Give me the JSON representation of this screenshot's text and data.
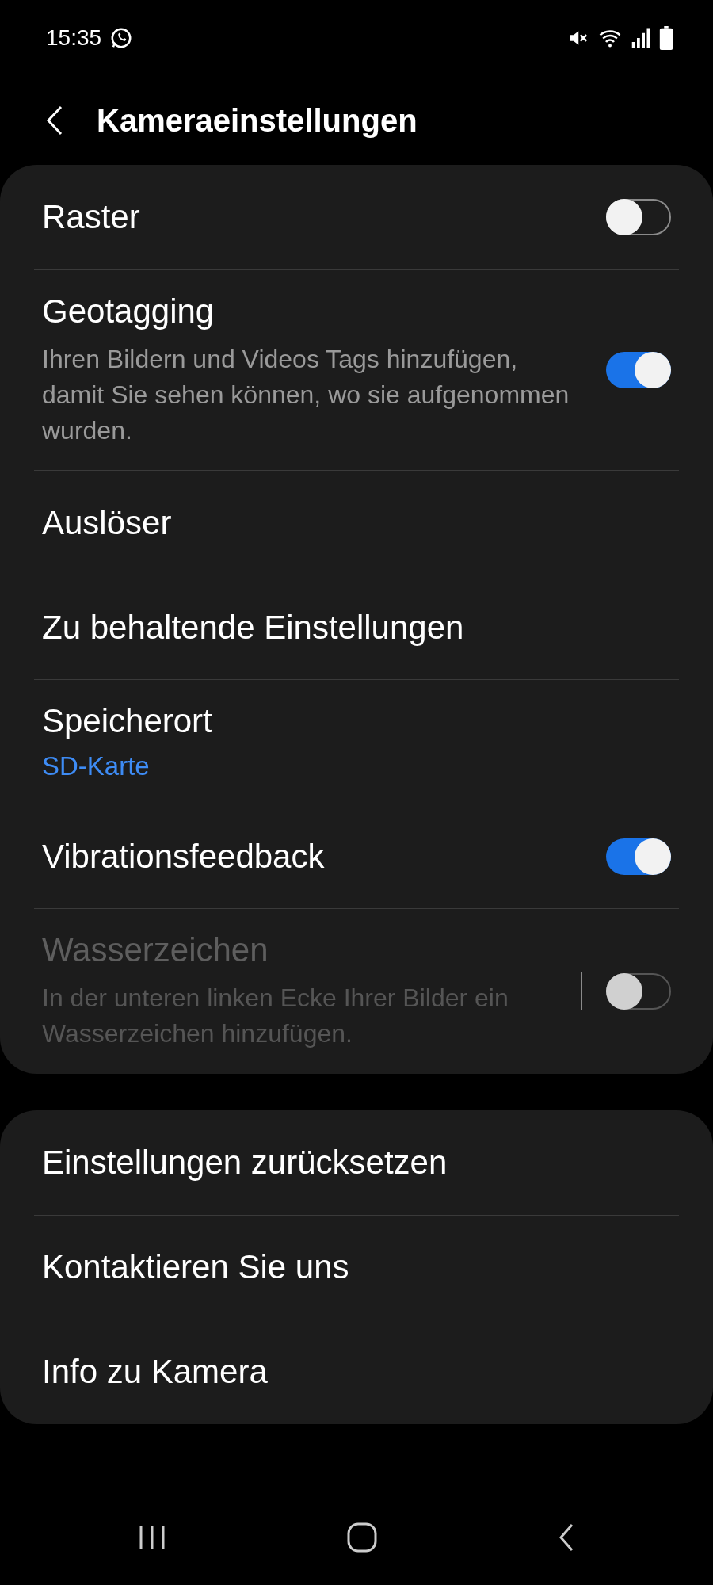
{
  "status_bar": {
    "time": "15:35"
  },
  "header": {
    "title": "Kameraeinstellungen"
  },
  "groups": [
    {
      "items": [
        {
          "kind": "toggle",
          "title": "Raster",
          "on": false,
          "disabled": false
        },
        {
          "kind": "toggle",
          "title": "Geotagging",
          "subtitle": "Ihren Bildern und Videos Tags hinzufügen, damit Sie sehen können, wo sie aufgenommen wurden.",
          "on": true,
          "disabled": false
        },
        {
          "kind": "link",
          "title": "Auslöser"
        },
        {
          "kind": "link",
          "title": "Zu behaltende Einstellungen"
        },
        {
          "kind": "link",
          "title": "Speicherort",
          "value": "SD-Karte"
        },
        {
          "kind": "toggle",
          "title": "Vibrationsfeedback",
          "on": true,
          "disabled": false
        },
        {
          "kind": "toggle",
          "title": "Wasserzeichen",
          "subtitle": "In der unteren linken Ecke Ihrer Bilder ein Wasserzeichen hinzufügen.",
          "on": false,
          "disabled": true
        }
      ]
    },
    {
      "items": [
        {
          "kind": "link",
          "title": "Einstellungen zurücksetzen"
        },
        {
          "kind": "link",
          "title": "Kontaktieren Sie uns"
        },
        {
          "kind": "link",
          "title": "Info zu Kamera"
        }
      ]
    }
  ]
}
